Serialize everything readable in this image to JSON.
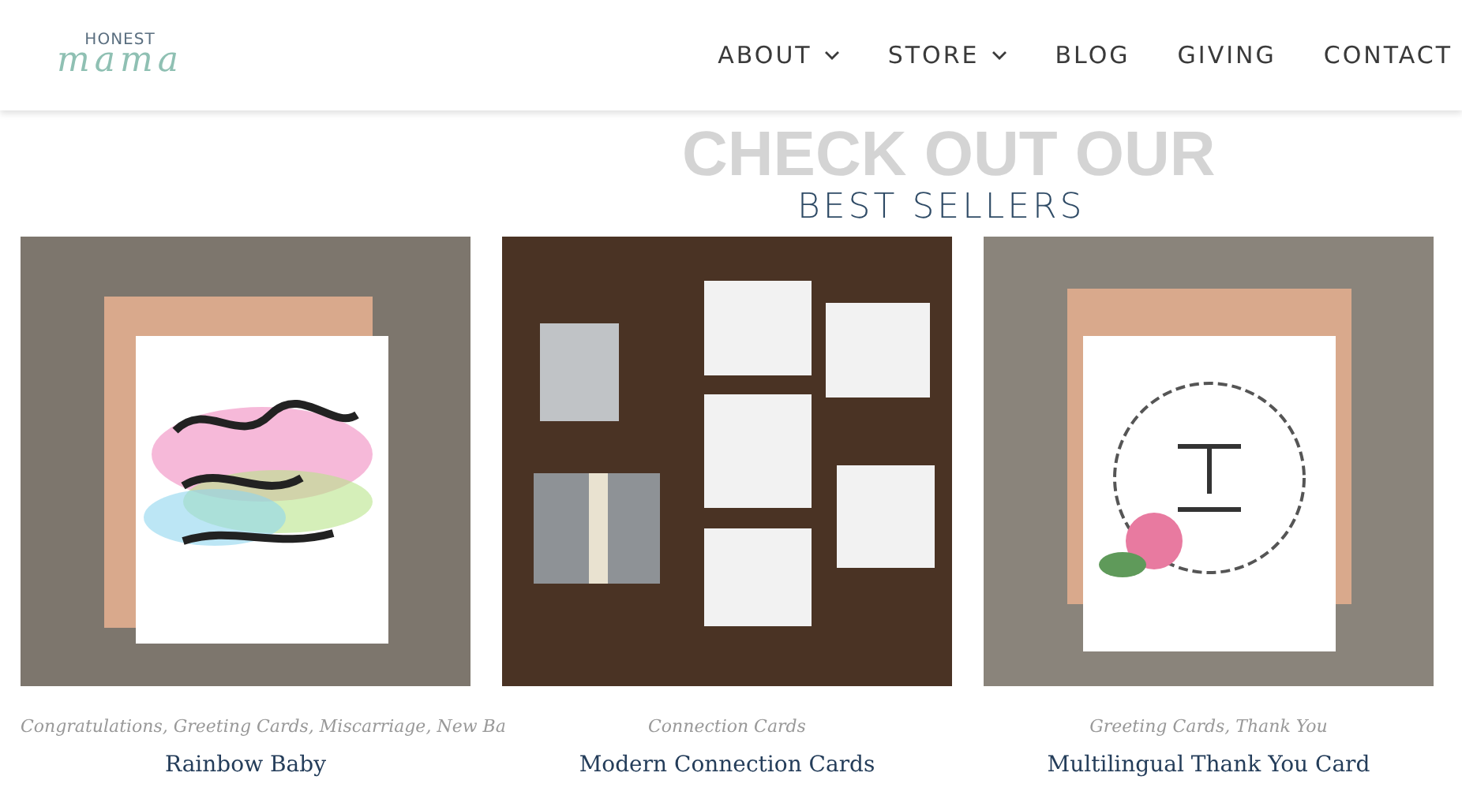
{
  "header": {
    "logo": {
      "top": "HONEST",
      "script": "mama"
    },
    "nav": [
      {
        "label": "ABOUT",
        "dropdown": true
      },
      {
        "label": "STORE",
        "dropdown": true
      },
      {
        "label": "BLOG",
        "dropdown": false
      },
      {
        "label": "GIVING",
        "dropdown": false
      },
      {
        "label": "CONTACT",
        "dropdown": false
      }
    ]
  },
  "section": {
    "backdrop_title": "CHECK OUT OUR",
    "title": "BEST SELLERS"
  },
  "category_separator": ",",
  "products": [
    {
      "kind": "rainbow",
      "categories": [
        "Congratulations",
        "Greeting Cards",
        "Miscarriage",
        "New Ba"
      ],
      "name": "Rainbow Baby"
    },
    {
      "kind": "flatlay",
      "categories": [
        "Connection Cards"
      ],
      "name": "Modern Connection Cards"
    },
    {
      "kind": "wreath",
      "categories": [
        "Greeting Cards",
        "Thank You"
      ],
      "name": "Multilingual Thank You Card"
    }
  ]
}
